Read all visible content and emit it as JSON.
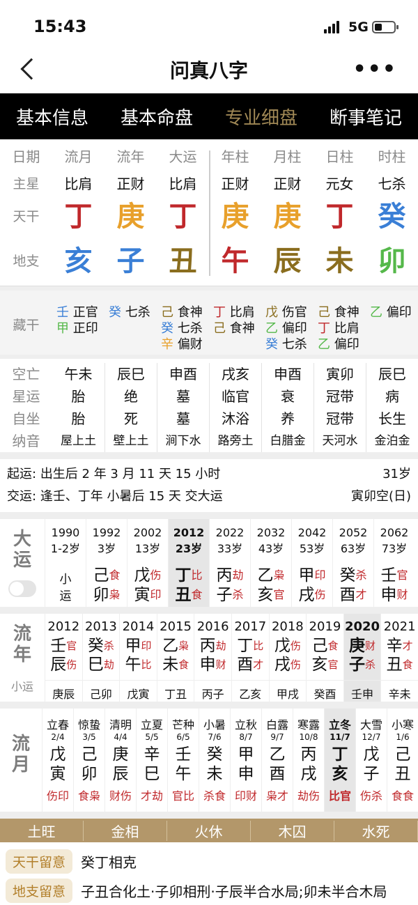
{
  "status": {
    "time": "15:43",
    "network": "5G"
  },
  "nav": {
    "title": "问真八字",
    "more": "•••"
  },
  "tabs": [
    "基本信息",
    "基本命盘",
    "专业细盘",
    "断事笔记"
  ],
  "colors": {
    "fire_red": "#c0282b",
    "metal_orange": "#e8a02b",
    "water_blue": "#3a7fd6",
    "earth_brown": "#8a6d1e",
    "wood_green": "#55b84a",
    "accent": "#a08855"
  },
  "pillars": {
    "headers": [
      "日期",
      "流月",
      "流年",
      "大运",
      "年柱",
      "月柱",
      "日柱",
      "时柱"
    ],
    "main_label": "主星",
    "main": [
      "比肩",
      "正财",
      "比肩",
      "正财",
      "正财",
      "元女",
      "七杀"
    ],
    "tg_label": "天干",
    "tg": [
      {
        "c": "丁",
        "col": "#c0282b"
      },
      {
        "c": "庚",
        "col": "#e8a02b"
      },
      {
        "c": "丁",
        "col": "#c0282b"
      },
      {
        "c": "庚",
        "col": "#e8a02b"
      },
      {
        "c": "庚",
        "col": "#e8a02b"
      },
      {
        "c": "丁",
        "col": "#c0282b"
      },
      {
        "c": "癸",
        "col": "#3a7fd6"
      }
    ],
    "dz_label": "地支",
    "dz": [
      {
        "c": "亥",
        "col": "#3a7fd6"
      },
      {
        "c": "子",
        "col": "#3a7fd6"
      },
      {
        "c": "丑",
        "col": "#8a6d1e"
      },
      {
        "c": "午",
        "col": "#c0282b"
      },
      {
        "c": "辰",
        "col": "#8a6d1e"
      },
      {
        "c": "未",
        "col": "#8a6d1e"
      },
      {
        "c": "卯",
        "col": "#55b84a"
      }
    ]
  },
  "canggan": {
    "label": "藏干",
    "cols": [
      [
        [
          "壬",
          "正官",
          "#3a7fd6"
        ],
        [
          "甲",
          "正印",
          "#55b84a"
        ]
      ],
      [
        [
          "癸",
          "七杀",
          "#3a7fd6"
        ]
      ],
      [
        [
          "己",
          "食神",
          "#8a6d1e"
        ],
        [
          "癸",
          "七杀",
          "#3a7fd6"
        ],
        [
          "辛",
          "偏财",
          "#e8a02b"
        ]
      ],
      [
        [
          "丁",
          "比肩",
          "#c0282b"
        ],
        [
          "己",
          "食神",
          "#8a6d1e"
        ]
      ],
      [
        [
          "戊",
          "伤官",
          "#8a6d1e"
        ],
        [
          "乙",
          "偏印",
          "#55b84a"
        ],
        [
          "癸",
          "七杀",
          "#3a7fd6"
        ]
      ],
      [
        [
          "己",
          "食神",
          "#8a6d1e"
        ],
        [
          "丁",
          "比肩",
          "#c0282b"
        ],
        [
          "乙",
          "偏印",
          "#55b84a"
        ]
      ],
      [
        [
          "乙",
          "偏印",
          "#55b84a"
        ]
      ]
    ]
  },
  "kong": {
    "labels": [
      "空亡",
      "星运",
      "自坐",
      "纳音"
    ],
    "rows": [
      [
        "午未",
        "辰巳",
        "申酉",
        "戌亥",
        "申酉",
        "寅卯",
        "辰巳"
      ],
      [
        "胎",
        "绝",
        "墓",
        "临官",
        "衰",
        "冠带",
        "病"
      ],
      [
        "胎",
        "死",
        "墓",
        "沐浴",
        "养",
        "冠带",
        "长生"
      ],
      [
        "屋上土",
        "壁上土",
        "涧下水",
        "路旁土",
        "白腊金",
        "天河水",
        "金泊金"
      ]
    ]
  },
  "info": {
    "qiyun_label": "起运:",
    "qiyun": "出生后 2 年 3 月 11 天 15 小时",
    "age": "31岁",
    "jiaoyun_label": "交运:",
    "jiaoyun": "逢壬、丁年 小暑后 15 天 交大运",
    "kong": "寅卯空(日)"
  },
  "dayun": {
    "side": [
      "大",
      "运"
    ],
    "items": [
      {
        "y": "1990",
        "a": "1-2岁",
        "s": "小运",
        "ts": [
          "",
          ""
        ],
        "cur": false
      },
      {
        "y": "1992",
        "a": "3岁",
        "s": "己卯",
        "ts": [
          "食",
          "枭"
        ],
        "cur": false
      },
      {
        "y": "2002",
        "a": "13岁",
        "s": "戊寅",
        "ts": [
          "伤",
          "印"
        ],
        "cur": false
      },
      {
        "y": "2012",
        "a": "23岁",
        "s": "丁丑",
        "ts": [
          "比",
          "食"
        ],
        "cur": true
      },
      {
        "y": "2022",
        "a": "33岁",
        "s": "丙子",
        "ts": [
          "劫",
          "杀"
        ],
        "cur": false
      },
      {
        "y": "2032",
        "a": "43岁",
        "s": "乙亥",
        "ts": [
          "枭",
          "官"
        ],
        "cur": false
      },
      {
        "y": "2042",
        "a": "53岁",
        "s": "甲戌",
        "ts": [
          "印",
          "伤"
        ],
        "cur": false
      },
      {
        "y": "2052",
        "a": "63岁",
        "s": "癸酉",
        "ts": [
          "杀",
          "才"
        ],
        "cur": false
      },
      {
        "y": "2062",
        "a": "73岁",
        "s": "壬申",
        "ts": [
          "官",
          "财"
        ],
        "cur": false
      }
    ]
  },
  "liunian": {
    "side": [
      "流",
      "年"
    ],
    "sub": "小运",
    "items": [
      {
        "y": "2012",
        "s": "壬辰",
        "ts": [
          "官",
          "伤"
        ],
        "x": "庚辰",
        "cur": false
      },
      {
        "y": "2013",
        "s": "癸巳",
        "ts": [
          "杀",
          "劫"
        ],
        "x": "己卯",
        "cur": false
      },
      {
        "y": "2014",
        "s": "甲午",
        "ts": [
          "印",
          "比"
        ],
        "x": "戊寅",
        "cur": false
      },
      {
        "y": "2015",
        "s": "乙未",
        "ts": [
          "枭",
          "食"
        ],
        "x": "丁丑",
        "cur": false
      },
      {
        "y": "2016",
        "s": "丙申",
        "ts": [
          "劫",
          "财"
        ],
        "x": "丙子",
        "cur": false
      },
      {
        "y": "2017",
        "s": "丁酉",
        "ts": [
          "比",
          "才"
        ],
        "x": "乙亥",
        "cur": false
      },
      {
        "y": "2018",
        "s": "戊戌",
        "ts": [
          "伤",
          "伤"
        ],
        "x": "甲戌",
        "cur": false
      },
      {
        "y": "2019",
        "s": "己亥",
        "ts": [
          "食",
          "官"
        ],
        "x": "癸酉",
        "cur": false
      },
      {
        "y": "2020",
        "s": "庚子",
        "ts": [
          "财",
          "杀"
        ],
        "x": "壬申",
        "cur": true
      },
      {
        "y": "2021",
        "s": "辛丑",
        "ts": [
          "才",
          "食"
        ],
        "x": "辛未",
        "cur": false
      }
    ]
  },
  "liuyue": {
    "side": [
      "流",
      "月"
    ],
    "items": [
      {
        "j": "立春",
        "d": "2/4",
        "s": "戊寅",
        "ts": "伤印",
        "cur": false
      },
      {
        "j": "惊蛰",
        "d": "3/5",
        "s": "己卯",
        "ts": "食枭",
        "cur": false
      },
      {
        "j": "清明",
        "d": "4/4",
        "s": "庚辰",
        "ts": "财伤",
        "cur": false
      },
      {
        "j": "立夏",
        "d": "5/5",
        "s": "辛巳",
        "ts": "才劫",
        "cur": false
      },
      {
        "j": "芒种",
        "d": "6/5",
        "s": "壬午",
        "ts": "官比",
        "cur": false
      },
      {
        "j": "小暑",
        "d": "7/6",
        "s": "癸未",
        "ts": "杀食",
        "cur": false
      },
      {
        "j": "立秋",
        "d": "8/7",
        "s": "甲申",
        "ts": "印财",
        "cur": false
      },
      {
        "j": "白露",
        "d": "9/7",
        "s": "乙酉",
        "ts": "枭才",
        "cur": false
      },
      {
        "j": "寒露",
        "d": "10/8",
        "s": "丙戌",
        "ts": "劫伤",
        "cur": false
      },
      {
        "j": "立冬",
        "d": "11/7",
        "s": "丁亥",
        "ts": "比官",
        "cur": true
      },
      {
        "j": "大雪",
        "d": "12/7",
        "s": "戊子",
        "ts": "伤杀",
        "cur": false
      },
      {
        "j": "小寒",
        "d": "1/6",
        "s": "己丑",
        "ts": "食食",
        "cur": false
      }
    ]
  },
  "wuxing": [
    "土旺",
    "金相",
    "火休",
    "木囚",
    "水死"
  ],
  "notes": [
    {
      "tag": "天干留意",
      "text": "癸丁相克"
    },
    {
      "tag": "地支留意",
      "text": "子丑合化土·子卯相刑·子辰半合水局;卯未半合木局"
    }
  ]
}
